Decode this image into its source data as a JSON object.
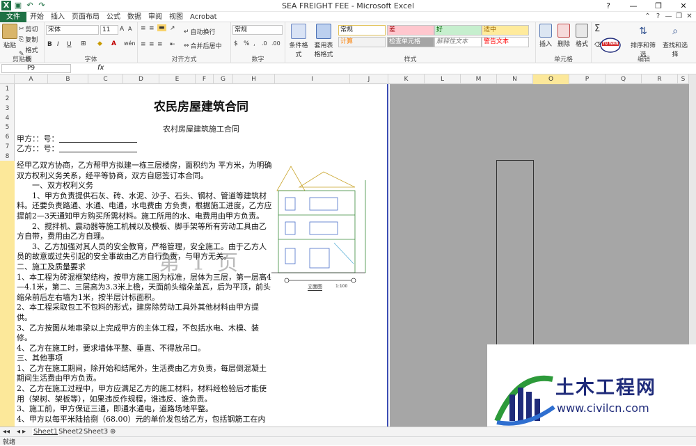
{
  "window": {
    "title": "SEA FREIGHT FEE - Microsoft Excel"
  },
  "menu": {
    "file": "文件",
    "tabs": [
      "开始",
      "插入",
      "页面布局",
      "公式",
      "数据",
      "审阅",
      "视图",
      "Acrobat"
    ]
  },
  "ribbon": {
    "clipboard": {
      "paste": "粘贴",
      "cut": "剪切",
      "copy": "复制",
      "format_painter": "格式刷",
      "label": "剪贴板"
    },
    "font": {
      "name": "宋体",
      "size": "11",
      "label": "字体",
      "bold": "B",
      "italic": "I",
      "underline": "U",
      "inc": "A",
      "dec": "A",
      "wen": "wén"
    },
    "alignment": {
      "wrap": "自动换行",
      "merge": "合并后居中",
      "label": "对齐方式"
    },
    "number": {
      "format": "常规",
      "label": "数字",
      "pct": "%",
      "comma": ","
    },
    "styles": {
      "cond": "条件格式",
      "table": "套用表格格式",
      "label": "样式",
      "items": [
        "常规",
        "差",
        "好",
        "适中",
        "计算",
        "检查单元格",
        "解释性文本",
        "警告文本"
      ]
    },
    "cells": {
      "insert": "插入",
      "delete": "删除",
      "format": "格式",
      "label": "单元格"
    },
    "editing": {
      "sum": "Σ",
      "clear": "清除",
      "sort": "排序和筛选",
      "find": "查找和选择",
      "label": "编辑"
    }
  },
  "formula_bar": {
    "cell": "P9",
    "fx": "fx"
  },
  "columns": [
    "A",
    "B",
    "C",
    "D",
    "E",
    "F",
    "G",
    "H",
    "I",
    "J",
    "K",
    "L",
    "M",
    "N",
    "O",
    "P",
    "Q",
    "R",
    "S",
    "T"
  ],
  "selected_column": "P",
  "rows": [
    "1",
    "2",
    "3",
    "4",
    "5",
    "6",
    "7",
    "8"
  ],
  "document": {
    "title": "农民房屋建筑合同",
    "subtitle": "农村房屋建筑施工合同",
    "party_a": "甲方：：号：",
    "party_b": "乙方：：号：",
    "paragraphs": [
      {
        "text": "经甲乙双方协商，乙方帮甲方拟建一栋三层楼房，面积约为 平方米，为明确双方权利义务关系，经平等协商，双方自愿签订本合同。",
        "indent": false
      },
      {
        "text": "一、双方权利义务",
        "indent": true
      },
      {
        "text": "1、甲方负责提供石灰、砖、水泥、沙子、石头、钢材、管道等建筑材料。还要负责路通、水通、电通，水电费由 方负责，根据施工进度，乙方应提前2—3天通知甲方购买所需材料。施工所用的水、电费用由甲方负责。",
        "indent": true
      },
      {
        "text": "2、搅拌机、震动器等施工机械以及模板、脚手架等所有劳动工具由乙方自带，费用由乙方自理。",
        "indent": true
      },
      {
        "text": "3、乙方加强对其人员的安全教育，严格管理，安全施工。由于乙方人员的故意或过失引起的安全事故由乙方自行负责，与甲方无关。",
        "indent": true
      },
      {
        "text": "二、施工及质量要求",
        "indent": false
      },
      {
        "text": "1、本工程为砖混框架结构，按甲方施工图为标准，层体为三层，第一层高4—4.1米，第二、三层高为3.3米上檐，天面前头缩朵盖瓦，后为平顶，前头缩朵前后左右墙为1米，按半层计标面积。",
        "indent": false
      },
      {
        "text": "2、本工程采取包工不包料的形式，建房除劳动工具外其他材料由甲方提供。",
        "indent": false
      },
      {
        "text": "3、乙方按图从地串梁以上完成甲方的主体工程，不包括水电、木模、装修。",
        "indent": false
      },
      {
        "text": "4、乙方在施工时，要求墙体平整、垂直、不得放吊口。",
        "indent": false
      },
      {
        "text": "三、其他事项",
        "indent": false
      },
      {
        "text": "1、乙方在施工期间，除开始和结尾外，生活费由乙方负责，每层倒混凝土期间生活费由甲方负责。",
        "indent": false
      },
      {
        "text": "2、乙方在施工过程中，甲方应满足乙方的施工材料，材料经检验后才能使用（架树、架板等），如果违反作规程，谁违反、谁负责。",
        "indent": false
      },
      {
        "text": "3、施工前，甲方保证三通，即通水通电，道路场地平整。",
        "indent": false
      },
      {
        "text": "4、甲方以每平米陆拾捌（68.00）元的单价发包给乙方，包括钢筋工在内",
        "indent": false
      }
    ],
    "watermark": "第 1 页",
    "drawing_caption": "立面图",
    "drawing_scale": "1:100"
  },
  "sheets": [
    "Sheet1",
    "Sheet2",
    "Sheet3"
  ],
  "status": "就绪",
  "logo": {
    "cn": "土木工程网",
    "url": "www.civilcn.com",
    "badge": "TU WAN"
  }
}
